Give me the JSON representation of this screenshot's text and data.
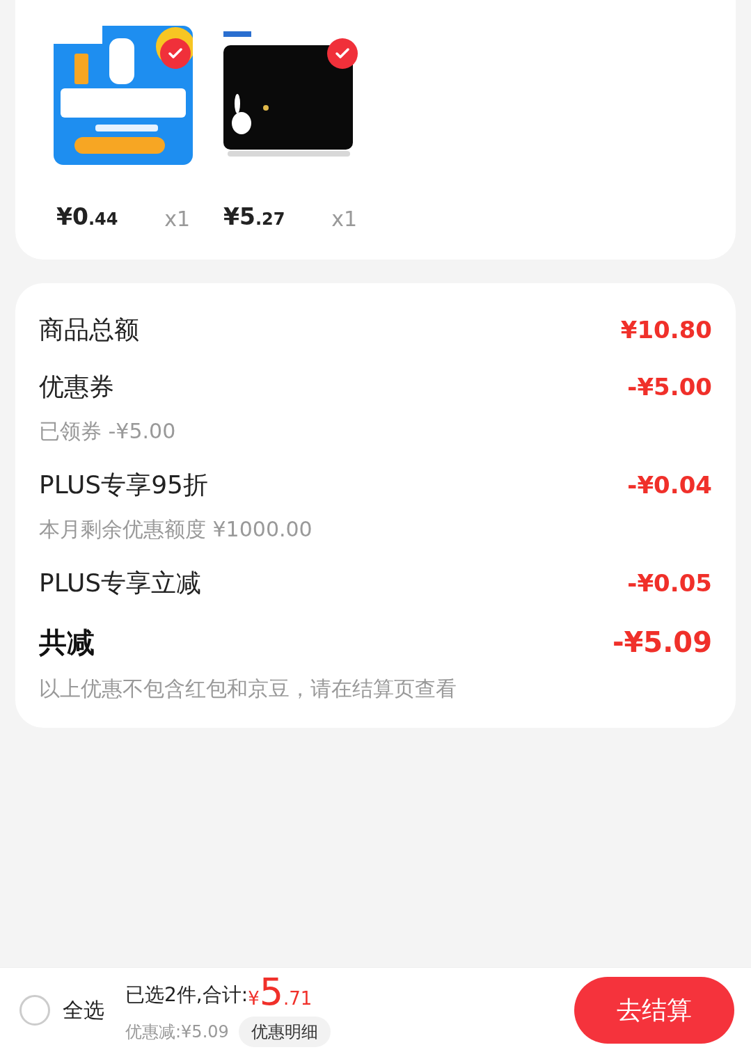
{
  "products": [
    {
      "selected": true,
      "price_main": "¥0",
      "price_decimal": ".44",
      "quantity": "x1"
    },
    {
      "selected": true,
      "price_main": "¥5",
      "price_decimal": ".27",
      "quantity": "x1"
    }
  ],
  "summary": {
    "rows": [
      {
        "label": "商品总额",
        "amount": "¥10.80"
      },
      {
        "label": "优惠券",
        "amount": "-¥5.00",
        "note": "已领券 -¥5.00"
      },
      {
        "label": "PLUS专享95折",
        "amount": "-¥0.04",
        "note": "本月剩余优惠额度 ¥1000.00"
      },
      {
        "label": "PLUS专享立减",
        "amount": "-¥0.05"
      }
    ],
    "total": {
      "label": "共减",
      "amount": "-¥5.09",
      "note": "以上优惠不包含红包和京豆，请在结算页查看"
    }
  },
  "bottom_bar": {
    "select_all": {
      "label": "全选",
      "checked": false
    },
    "selected_text": "已选2件,合计:",
    "total_currency": "¥",
    "total_main": "5",
    "total_decimal": ".71",
    "discount_text": "优惠减:¥5.09",
    "detail_button": "优惠明细",
    "checkout_button": "去结算"
  }
}
